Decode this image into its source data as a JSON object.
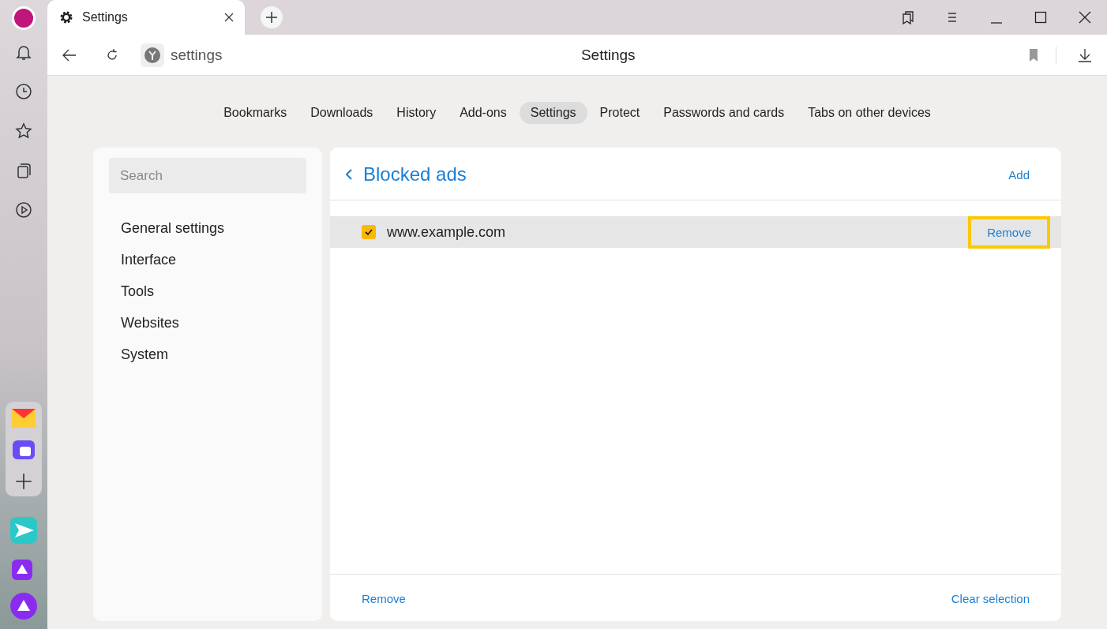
{
  "tab": {
    "title": "Settings"
  },
  "address": {
    "text": "settings"
  },
  "page_title": "Settings",
  "nav_tabs": [
    {
      "label": "Bookmarks",
      "selected": false
    },
    {
      "label": "Downloads",
      "selected": false
    },
    {
      "label": "History",
      "selected": false
    },
    {
      "label": "Add-ons",
      "selected": false
    },
    {
      "label": "Settings",
      "selected": true
    },
    {
      "label": "Protect",
      "selected": false
    },
    {
      "label": "Passwords and cards",
      "selected": false
    },
    {
      "label": "Tabs on other devices",
      "selected": false
    }
  ],
  "sidebar": {
    "search": {
      "placeholder": "Search"
    },
    "items": [
      "General settings",
      "Interface",
      "Tools",
      "Websites",
      "System"
    ]
  },
  "panel": {
    "title": "Blocked ads",
    "add": "Add",
    "rows": [
      {
        "site": "www.example.com",
        "checked": true,
        "action": "Remove",
        "highlighted": true
      }
    ],
    "footer_left": "Remove",
    "footer_right": "Clear selection"
  }
}
